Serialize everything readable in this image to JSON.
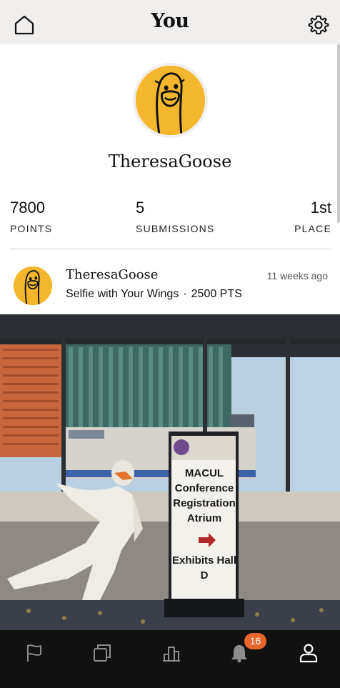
{
  "header": {
    "title": "You",
    "home_icon": "home-icon",
    "settings_icon": "gear-icon"
  },
  "profile": {
    "username": "TheresaGoose",
    "avatar_icon": "goose-avatar-icon",
    "avatar_color": "#f3b62d"
  },
  "stats": {
    "points_value": "7800",
    "points_label": "POINTS",
    "submissions_value": "5",
    "submissions_label": "SUBMISSIONS",
    "place_value": "1st",
    "place_label": "PLACE"
  },
  "post": {
    "username": "TheresaGoose",
    "time": "11 weeks ago",
    "challenge": "Selfie with Your Wings",
    "separator": "·",
    "points": "2500 PTS"
  },
  "photo": {
    "sign_lines_1": "MACUL Conference Registration Atrium",
    "sign_lines_2": "Exhibits Hall D"
  },
  "bottom_nav": {
    "items": [
      "flag-icon",
      "cards-icon",
      "leaderboard-icon",
      "bell-icon",
      "user-icon"
    ],
    "notification_count": "16",
    "badge_color": "#e8652c"
  }
}
